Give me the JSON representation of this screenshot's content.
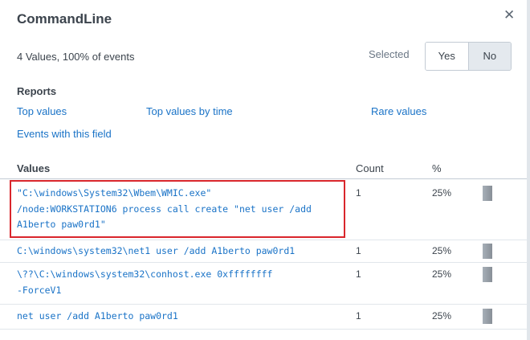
{
  "panel": {
    "title": "CommandLine",
    "close_glyph": "✕",
    "summary": "4 Values, 100% of events",
    "selected_label": "Selected",
    "toggle": {
      "yes": "Yes",
      "no": "No",
      "active": "No"
    }
  },
  "reports": {
    "heading": "Reports",
    "links": {
      "top_values": "Top values",
      "top_values_by_time": "Top values by time",
      "rare_values": "Rare values",
      "events_with_field": "Events with this field"
    }
  },
  "table": {
    "headers": {
      "values": "Values",
      "count": "Count",
      "percent": "%"
    },
    "rows": [
      {
        "value": "\"C:\\windows\\System32\\Wbem\\WMIC.exe\"\n/node:WORKSTATION6 process call create \"net user /add\nA1berto paw0rd1\"",
        "count": "1",
        "percent": "25%",
        "fraction": 0.25,
        "highlighted": true
      },
      {
        "value": "C:\\windows\\system32\\net1 user /add A1berto paw0rd1",
        "count": "1",
        "percent": "25%",
        "fraction": 0.25,
        "highlighted": false
      },
      {
        "value": "\\??\\C:\\windows\\system32\\conhost.exe 0xffffffff\n-ForceV1",
        "count": "1",
        "percent": "25%",
        "fraction": 0.25,
        "highlighted": false
      },
      {
        "value": "net user /add A1berto paw0rd1",
        "count": "1",
        "percent": "25%",
        "fraction": 0.25,
        "highlighted": false
      }
    ]
  },
  "colors": {
    "link": "#1a73c7",
    "highlight_border": "#d9262c",
    "bar": "#9aa2ab",
    "toggle_active_bg": "#e4e9ee"
  }
}
